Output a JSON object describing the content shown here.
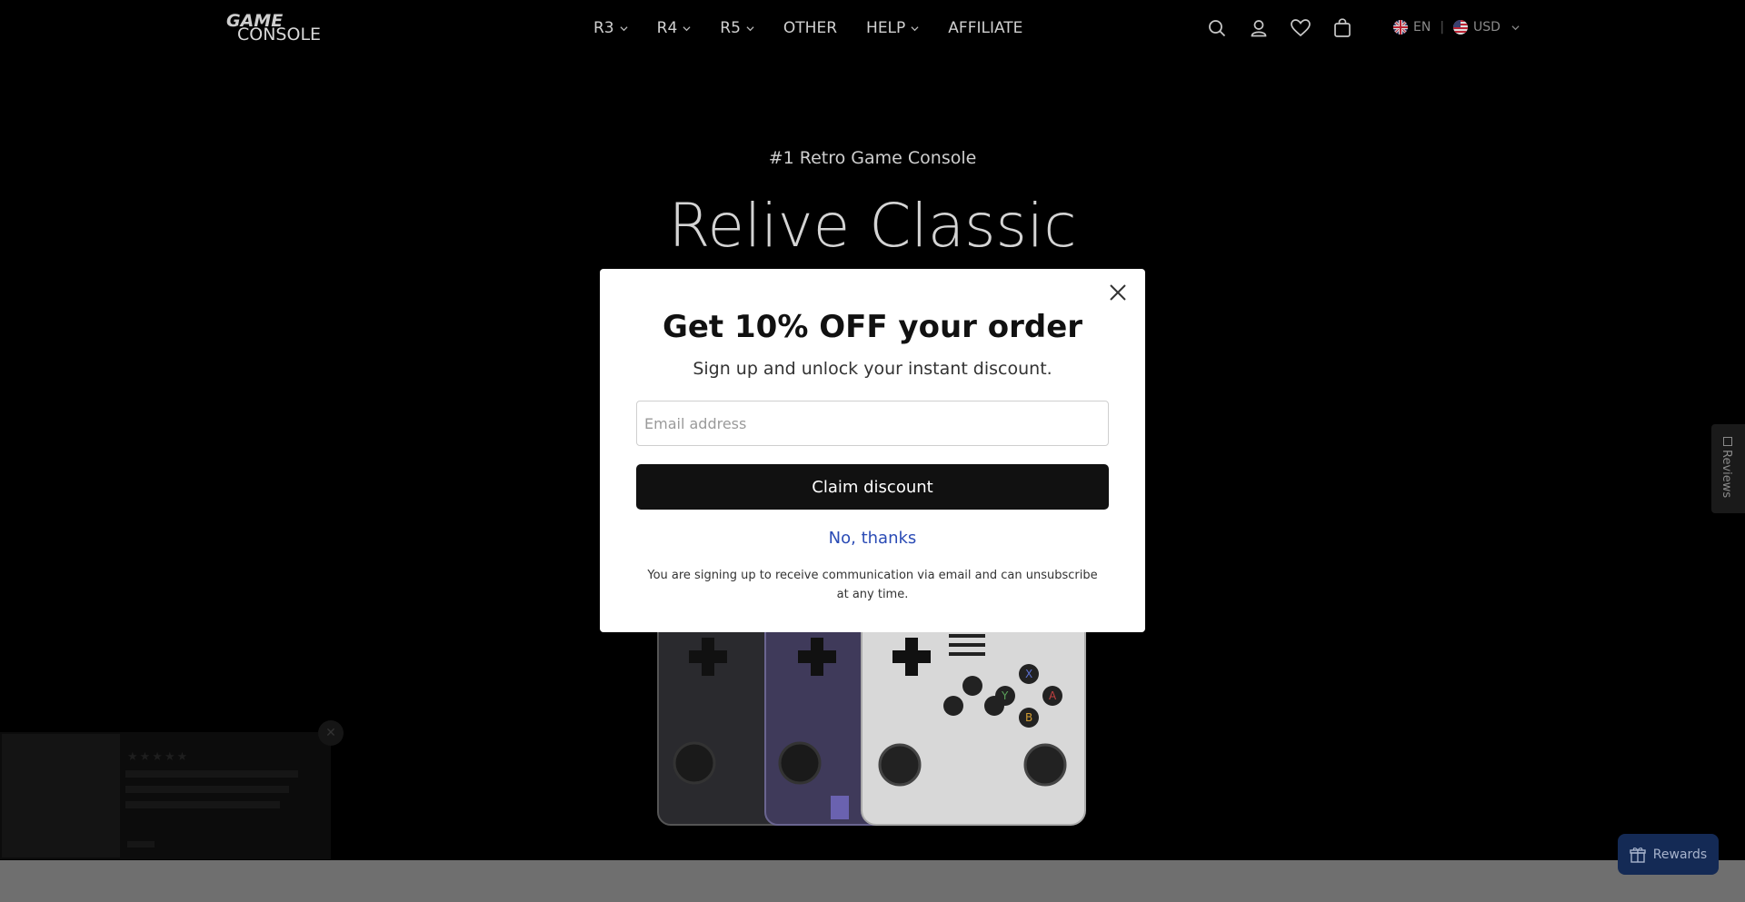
{
  "header": {
    "logo_line1": "GAME",
    "logo_line2": "CONSOLE",
    "nav": [
      {
        "label": "R3",
        "has_dropdown": true
      },
      {
        "label": "R4",
        "has_dropdown": true
      },
      {
        "label": "R5",
        "has_dropdown": true
      },
      {
        "label": "OTHER",
        "has_dropdown": false
      },
      {
        "label": "HELP",
        "has_dropdown": true
      },
      {
        "label": "AFFILIATE",
        "has_dropdown": false
      }
    ],
    "icons": [
      "search-icon",
      "account-icon",
      "wishlist-heart-icon",
      "cart-bag-icon"
    ],
    "language": "EN",
    "currency": "USD"
  },
  "hero": {
    "subtitle": "#1 Retro Game Console",
    "title": "Relive Classic"
  },
  "popup": {
    "title": "Get 10% OFF your order",
    "subtitle": "Sign up and unlock your instant discount.",
    "email_placeholder": "Email address",
    "email_value": "",
    "claim_label": "Claim discount",
    "decline_label": "No, thanks",
    "legal": "You are signing up to receive communication via email and can unsubscribe at any time."
  },
  "reviews_tab": {
    "label": "Reviews"
  },
  "review_popup": {
    "stars": "★★★★★"
  },
  "rewards": {
    "label": "Rewards"
  },
  "colors": {
    "background": "#000000",
    "modal_bg": "#ffffff",
    "button_dark": "#111111",
    "link_blue": "#2a4bb5",
    "rewards_bg": "#142a55"
  }
}
